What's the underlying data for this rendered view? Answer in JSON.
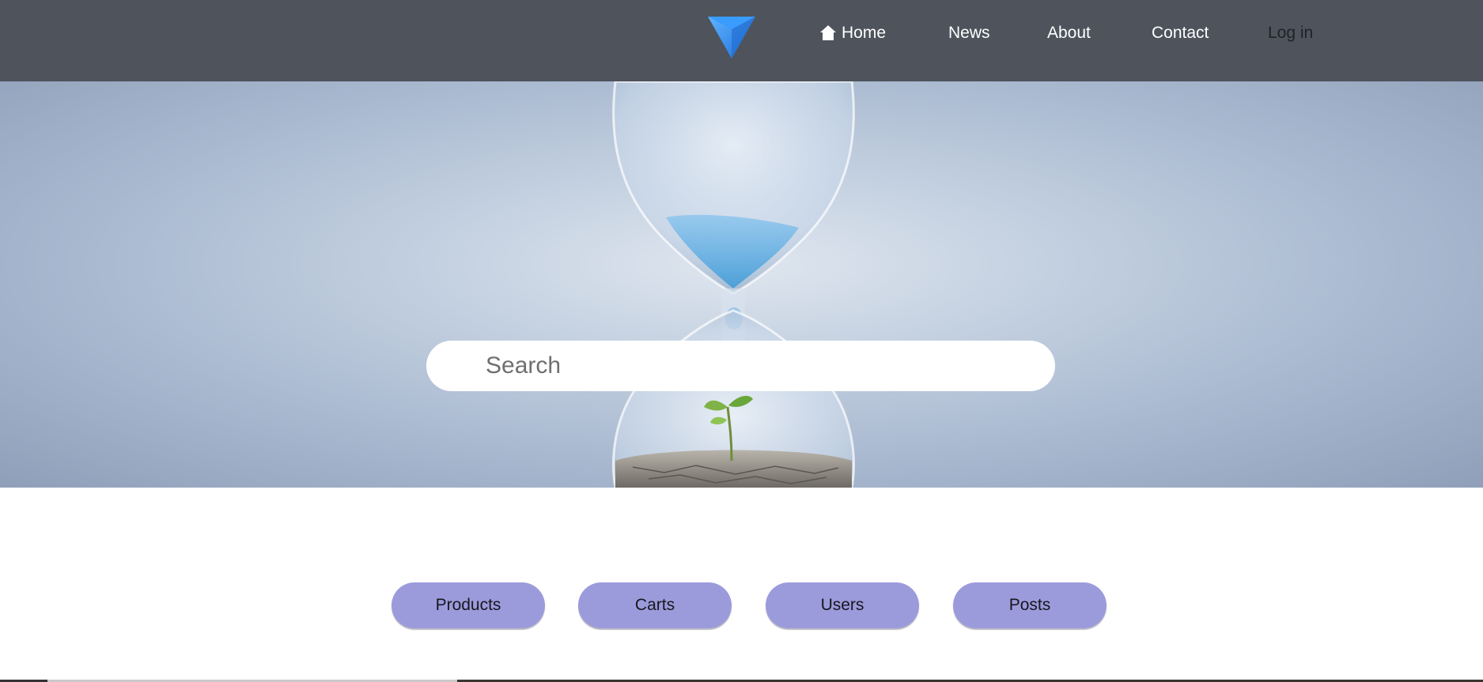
{
  "nav": {
    "logo_icon": "triangle-logo-icon",
    "home_icon": "home-icon",
    "items": [
      {
        "label": "Home"
      },
      {
        "label": "News"
      },
      {
        "label": "About"
      },
      {
        "label": "Contact"
      },
      {
        "label": "Log in"
      }
    ]
  },
  "search": {
    "placeholder": "Search",
    "value": ""
  },
  "categories": [
    {
      "label": "Products"
    },
    {
      "label": "Carts"
    },
    {
      "label": "Users"
    },
    {
      "label": "Posts"
    }
  ],
  "colors": {
    "topbar": "#4e535c",
    "pill": "#9b9bdc",
    "logo": "#2f8ff0"
  }
}
